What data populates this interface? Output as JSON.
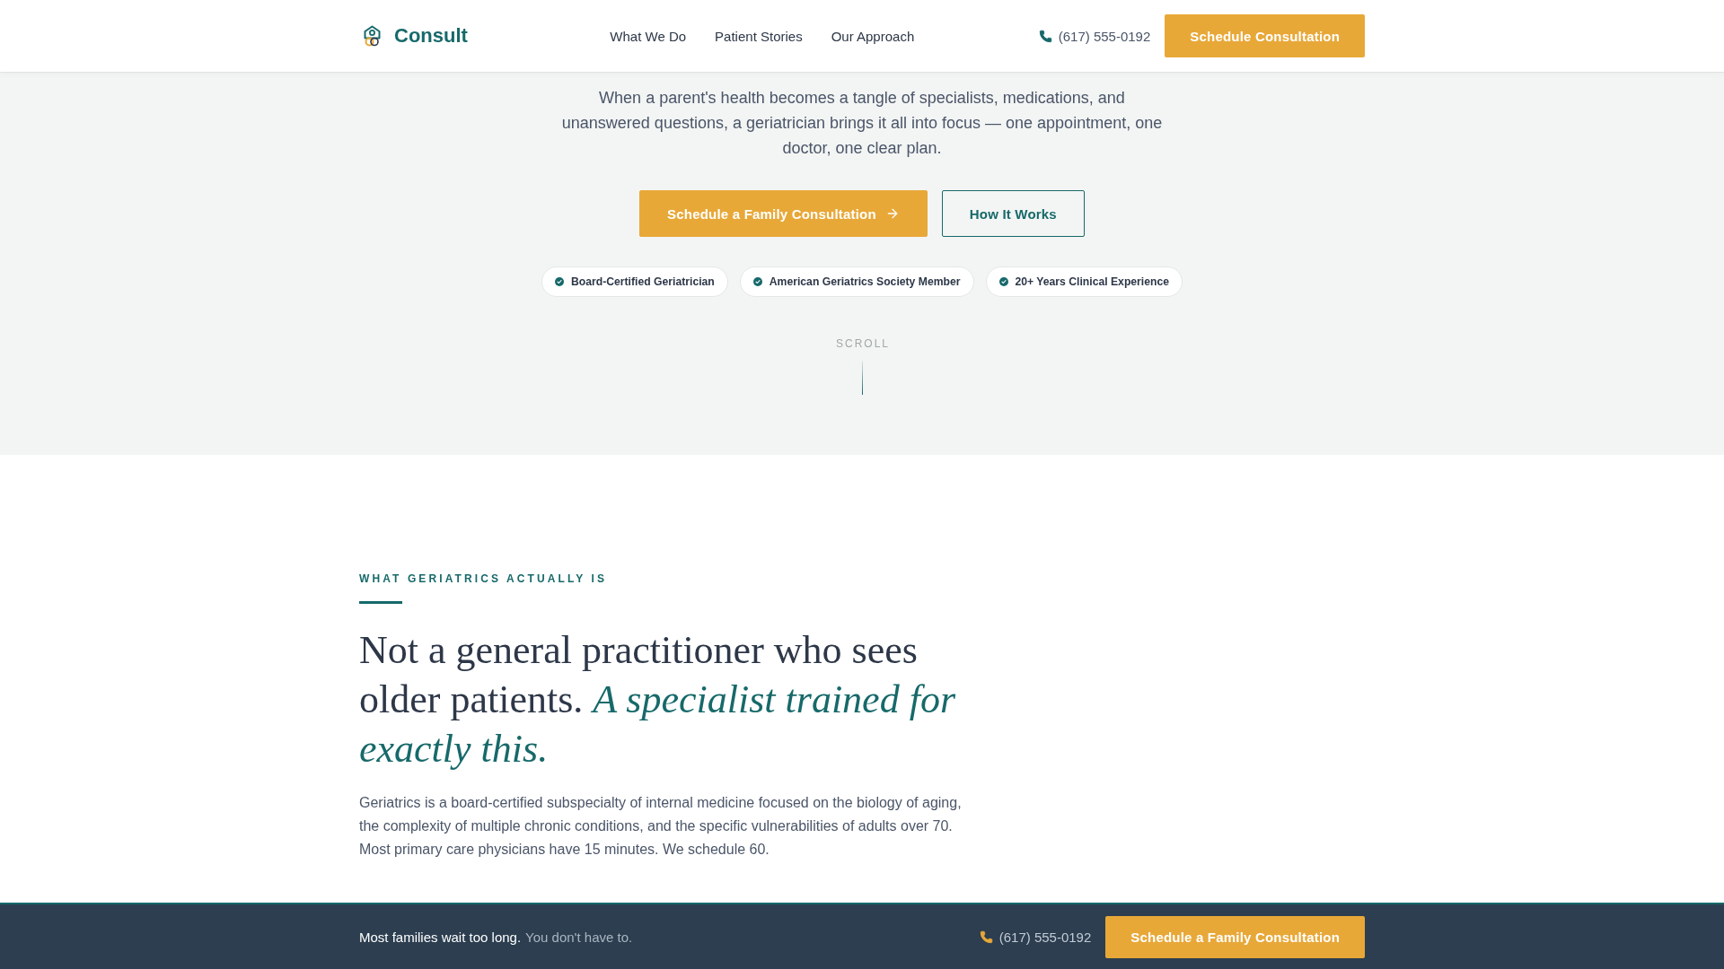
{
  "header": {
    "logo": "Consult",
    "nav": [
      {
        "label": "What We Do"
      },
      {
        "label": "Patient Stories"
      },
      {
        "label": "Our Approach"
      }
    ],
    "phone": "(617) 555-0192",
    "cta": "Schedule Consultation"
  },
  "hero": {
    "intro": "When a parent's health becomes a tangle of specialists, medications, and unanswered questions, a geriatrician brings it all into focus — one appointment, one doctor, one clear plan.",
    "buttons": [
      {
        "label": "Schedule a Family Consultation",
        "kind": "primary"
      },
      {
        "label": "How It Works",
        "kind": "secondary"
      }
    ],
    "badges": [
      "Board-Certified Geriatrician",
      "American Geriatrics Society Member",
      "20+ Years Clinical Experience"
    ],
    "scroll_hint": "SCROLL"
  },
  "section": {
    "eyebrow": "WHAT GERIATRICS ACTUALLY IS",
    "heading": "Not a general practitioner who sees older patients. *A specialist trained for exactly this.*",
    "body": "Geriatrics is a board-certified subspecialty of internal medicine focused on the biology of aging, the complexity of multiple chronic conditions, and the specific vulnerabilities of adults over 70. Most primary care physicians have 15 minutes. We schedule 60."
  },
  "bottom_bar": {
    "message": "Most families wait too long.",
    "submessage": "You don't have to.",
    "phone": "(617) 555-0192",
    "cta": "Schedule a Family Consultation"
  }
}
